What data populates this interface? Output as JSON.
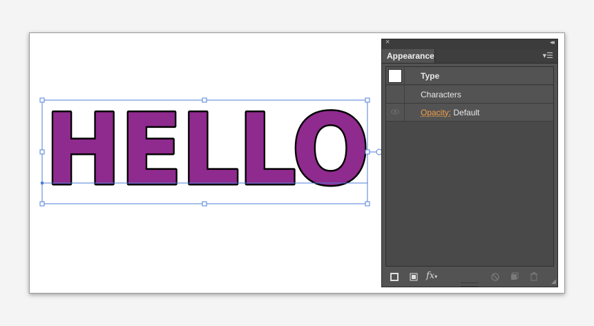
{
  "artboard": {
    "text": "HELLO"
  },
  "colors": {
    "fill": "#8f2a8e",
    "stroke": "#000000",
    "selection": "#4e7ed8"
  },
  "panel": {
    "tab": "Appearance",
    "rows": {
      "type": "Type",
      "characters": "Characters",
      "opacity_label": "Opacity:",
      "opacity_value": "Default"
    },
    "icons": {
      "close": "close-icon",
      "collapse": "collapse-icon",
      "menu": "panel-menu-icon",
      "visibility": "eye-icon",
      "add_stroke": "new-stroke-icon",
      "add_fill": "new-fill-icon",
      "fx": "fx-icon",
      "clear": "clear-appearance-icon",
      "duplicate": "duplicate-item-icon",
      "delete": "trash-icon"
    },
    "fx_label": "fx"
  }
}
